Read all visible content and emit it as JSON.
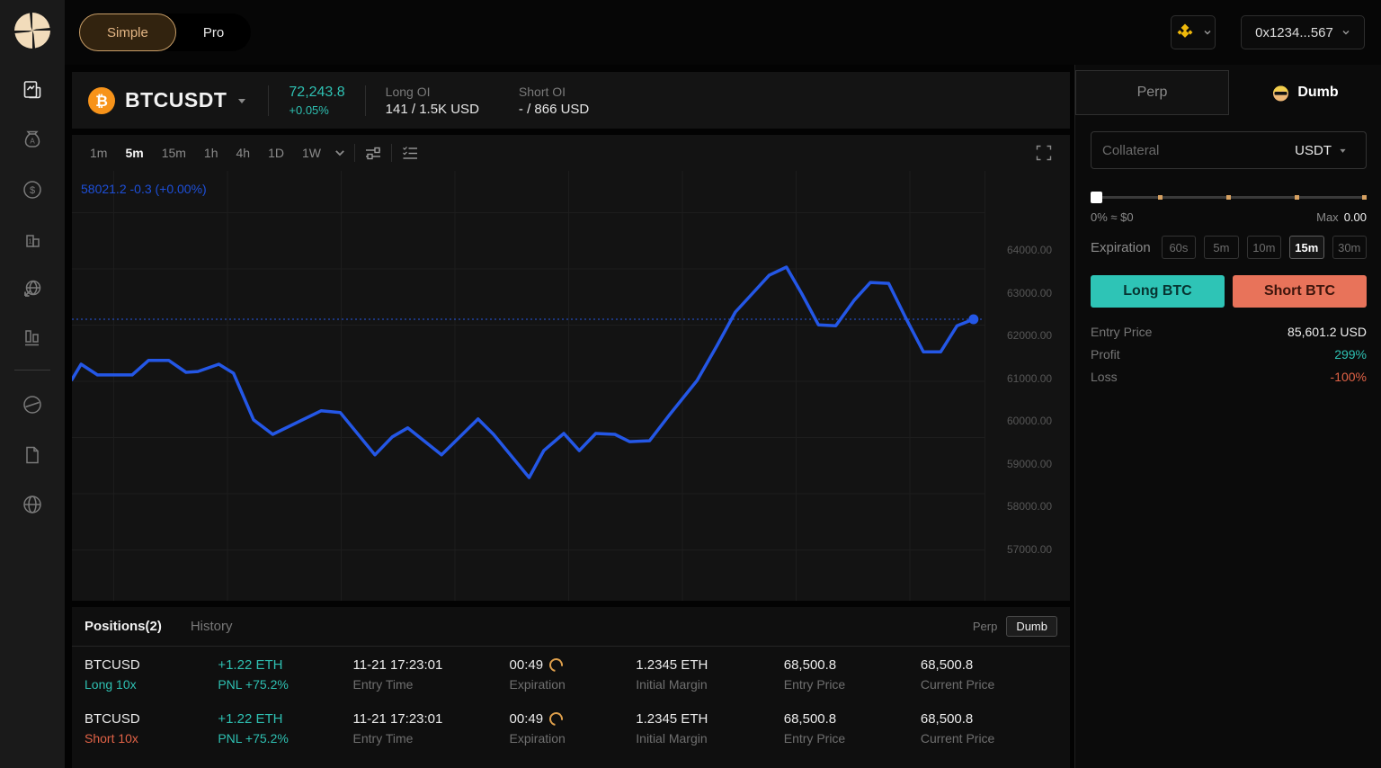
{
  "colors": {
    "teal": "#2ec0b2",
    "salmon": "#e8735a",
    "chart_blue": "#2457e6",
    "bnb_yellow": "#f0b90b",
    "btc_orange": "#f7931a",
    "accent_tan": "#d8a262"
  },
  "topbar": {
    "mode_simple": "Simple",
    "mode_pro": "Pro",
    "wallet_address": "0x1234...567"
  },
  "sidebar": {
    "icons": [
      "trade",
      "rewards",
      "earn",
      "leaderboard",
      "referral",
      "portfolio",
      "limit",
      "docs",
      "language"
    ]
  },
  "ticker": {
    "pair": "BTCUSDT",
    "price": "72,243.8",
    "change": "+0.05%",
    "long_oi_label": "Long OI",
    "long_oi_value": "141 / 1.5K USD",
    "short_oi_label": "Short OI",
    "short_oi_value": "- / 866 USD"
  },
  "chart": {
    "timeframes": [
      "1m",
      "5m",
      "15m",
      "1h",
      "4h",
      "1D",
      "1W"
    ],
    "active_timeframe": "5m"
  },
  "chart_data": {
    "type": "line",
    "symbol": "BTCUSDT",
    "interval": "5m",
    "legend": "58021.2 -0.3 (+0.00%)",
    "y_ticks": [
      64000,
      63000,
      62000,
      61000,
      60000,
      59000,
      58000,
      57000
    ],
    "ylim": [
      55800,
      65850
    ],
    "current_price": 62380,
    "grid": true,
    "points": [
      [
        0,
        60970
      ],
      [
        1.0,
        61330
      ],
      [
        2.8,
        61080
      ],
      [
        6.6,
        61080
      ],
      [
        8.4,
        61420
      ],
      [
        10.6,
        61420
      ],
      [
        12.5,
        61140
      ],
      [
        13.8,
        61160
      ],
      [
        16.1,
        61330
      ],
      [
        17.7,
        61120
      ],
      [
        19.9,
        60030
      ],
      [
        22.0,
        59690
      ],
      [
        27.3,
        60240
      ],
      [
        29.4,
        60200
      ],
      [
        33.2,
        59210
      ],
      [
        35.1,
        59630
      ],
      [
        36.8,
        59840
      ],
      [
        40.5,
        59210
      ],
      [
        44.5,
        60050
      ],
      [
        46.2,
        59690
      ],
      [
        50.1,
        58680
      ],
      [
        51.7,
        59310
      ],
      [
        53.9,
        59710
      ],
      [
        55.6,
        59310
      ],
      [
        57.4,
        59710
      ],
      [
        59.5,
        59690
      ],
      [
        61.1,
        59520
      ],
      [
        63.3,
        59540
      ],
      [
        65.5,
        60150
      ],
      [
        68.5,
        60950
      ],
      [
        70.7,
        61770
      ],
      [
        72.7,
        62550
      ],
      [
        74.6,
        62990
      ],
      [
        76.4,
        63410
      ],
      [
        78.3,
        63600
      ],
      [
        80.0,
        62970
      ],
      [
        81.8,
        62250
      ],
      [
        83.7,
        62230
      ],
      [
        85.7,
        62820
      ],
      [
        87.5,
        63240
      ],
      [
        89.5,
        63220
      ],
      [
        91.4,
        62400
      ],
      [
        93.3,
        61620
      ],
      [
        95.2,
        61620
      ],
      [
        97.0,
        62230
      ],
      [
        98.8,
        62380
      ]
    ]
  },
  "trade_panel": {
    "tab_perp": "Perp",
    "tab_dumb": "Dumb",
    "collateral_placeholder": "Collateral",
    "collateral_asset": "USDT",
    "slider_left": "0% ≈ $0",
    "max_label": "Max",
    "max_value": "0.00",
    "expiration_label": "Expiration",
    "expirations": [
      "60s",
      "5m",
      "10m",
      "15m",
      "30m"
    ],
    "active_expiration": "15m",
    "long_label": "Long BTC",
    "short_label": "Short BTC",
    "entry_price_label": "Entry Price",
    "entry_price_value": "85,601.2 USD",
    "profit_label": "Profit",
    "profit_value": "299%",
    "loss_label": "Loss",
    "loss_value": "-100%"
  },
  "positions": {
    "tab_positions": "Positions(2)",
    "tab_history": "History",
    "filter_perp": "Perp",
    "filter_dumb": "Dumb",
    "rows": [
      {
        "pair": "BTCUSD",
        "side": "Long 10x",
        "size": "+1.22 ETH",
        "pnl": "PNL +75.2%",
        "entry_time": "11-21 17:23:01",
        "entry_time_label": "Entry Time",
        "expiration": "00:49",
        "expiration_label": "Expiration",
        "initial_margin": "1.2345 ETH",
        "initial_margin_label": "Initial Margin",
        "entry_price": "68,500.8",
        "entry_price_label": "Entry Price",
        "current_price": "68,500.8",
        "current_price_label": "Current Price"
      },
      {
        "pair": "BTCUSD",
        "side": "Short 10x",
        "size": "+1.22 ETH",
        "pnl": "PNL +75.2%",
        "entry_time": "11-21 17:23:01",
        "entry_time_label": "Entry Time",
        "expiration": "00:49",
        "expiration_label": "Expiration",
        "initial_margin": "1.2345 ETH",
        "initial_margin_label": "Initial Margin",
        "entry_price": "68,500.8",
        "entry_price_label": "Entry Price",
        "current_price": "68,500.8",
        "current_price_label": "Current Price"
      }
    ]
  }
}
